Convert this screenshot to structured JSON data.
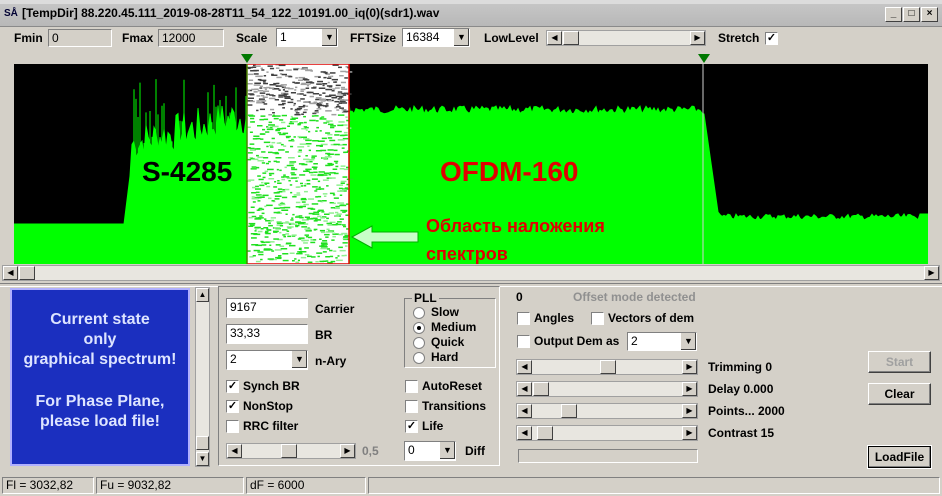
{
  "window": {
    "title": "[TempDir] 88.220.45.111_2019-08-28T11_54_122_10191.00_iq(0)(sdr1).wav",
    "icon_text": "SÅ",
    "controls": [
      "_",
      "□",
      "×"
    ]
  },
  "toolbar": {
    "fmin_label": "Fmin",
    "fmin_value": "0",
    "fmax_label": "Fmax",
    "fmax_value": "12000",
    "scale_label": "Scale",
    "scale_value": "1",
    "fftsize_label": "FFTSize",
    "fftsize_value": "16384",
    "lowlevel_label": "LowLevel",
    "lowlevel_level": 0.01,
    "stretch_label": "Stretch",
    "stretch_checked": true
  },
  "spectrum": {
    "label_left": "S-4285",
    "label_right": "OFDM-160",
    "annotation_line1": "Область наложения",
    "annotation_line2": "спектров",
    "label_left_color": "#000000",
    "label_right_color": "#e00000",
    "annotation_color": "#e00000",
    "signal_color": "#00ff00",
    "overlap_box_color": "#e00000"
  },
  "state_box": {
    "line1": "Current state",
    "line2": "only",
    "line3": "graphical spectrum!",
    "line4": "For Phase Plane,",
    "line5": "please load file!"
  },
  "demod": {
    "carrier_value": "9167",
    "carrier_label": "Carrier",
    "br_value": "33,33",
    "br_label": "BR",
    "nary_value": "2",
    "nary_label": "n-Ary",
    "pll_title": "PLL",
    "pll_options": [
      "Slow",
      "Medium",
      "Quick",
      "Hard"
    ],
    "pll_selected": "Medium",
    "synch_br_label": "Synch BR",
    "synch_br_checked": true,
    "nonstop_label": "NonStop",
    "nonstop_checked": true,
    "rrc_label": "RRC filter",
    "rrc_checked": false,
    "autoreset_label": "AutoReset",
    "autoreset_checked": false,
    "transitions_label": "Transitions",
    "transitions_checked": false,
    "life_label": "Life",
    "life_checked": true,
    "rrc_slider_value": "0,5",
    "diff_value": "0",
    "diff_label": "Diff"
  },
  "right_panel": {
    "zero_value": "0",
    "offset_text": "Offset mode detected",
    "angles_label": "Angles",
    "angles_checked": false,
    "vectors_label": "Vectors of dem",
    "vectors_checked": false,
    "output_label": "Output Dem as",
    "output_checked": false,
    "output_value": "2",
    "trimming_label": "Trimming 0",
    "delay_label": "Delay  0.000",
    "points_label": "Points... 2000",
    "contrast_label": "Contrast 15",
    "start_label": "Start",
    "clear_label": "Clear",
    "loadfile_label": "LoadFile"
  },
  "status": {
    "fl": "Fl = 3032,82",
    "fu": "Fu = 9032,82",
    "df": "dF = 6000"
  }
}
